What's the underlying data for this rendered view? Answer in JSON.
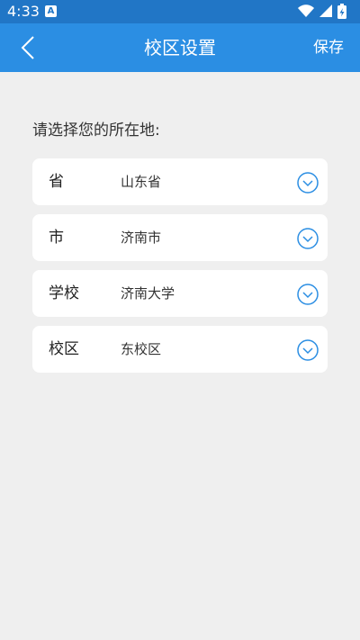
{
  "status_bar": {
    "time": "4:33",
    "notification_icon": "a-notification-icon",
    "icons": [
      "wifi-icon",
      "signal-icon",
      "battery-icon"
    ]
  },
  "app_bar": {
    "title": "校区设置",
    "save_label": "保存",
    "back_icon": "chevron-left-icon"
  },
  "form": {
    "prompt": "请选择您的所在地:",
    "rows": [
      {
        "label": "省",
        "value": "山东省"
      },
      {
        "label": "市",
        "value": "济南市"
      },
      {
        "label": "学校",
        "value": "济南大学"
      },
      {
        "label": "校区",
        "value": "东校区"
      }
    ]
  },
  "colors": {
    "status_bar": "#2176c6",
    "app_bar": "#2b8ee3",
    "accent": "#2b8ee3",
    "background": "#efefef"
  }
}
